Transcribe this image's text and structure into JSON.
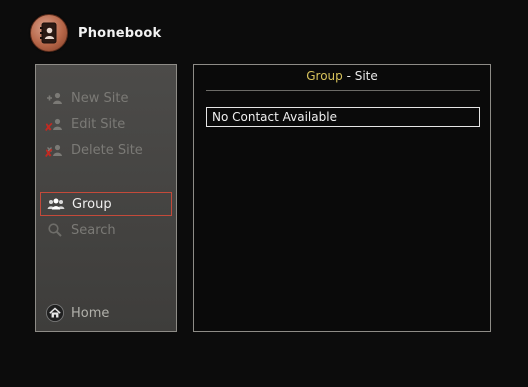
{
  "app": {
    "title": "Phonebook",
    "icon": "address-book-icon"
  },
  "sidebar": {
    "items": [
      {
        "label": "New Site",
        "icon": "add-contact-icon",
        "enabled": false
      },
      {
        "label": "Edit Site",
        "icon": "edit-contact-icon",
        "enabled": false
      },
      {
        "label": "Delete Site",
        "icon": "delete-contact-icon",
        "enabled": false
      },
      {
        "label": "Group",
        "icon": "group-icon",
        "selected": true
      },
      {
        "label": "Search",
        "icon": "search-icon",
        "enabled": false
      }
    ],
    "home": {
      "label": "Home",
      "icon": "home-icon"
    }
  },
  "content": {
    "title_group": "Group",
    "title_separator": " - ",
    "title_site": "Site",
    "rows": [
      "No Contact Available"
    ]
  },
  "colors": {
    "background": "#0c0c0c",
    "panel": "#4c4b49",
    "panel_border": "#8e8c87",
    "title_accent": "#d7c25b",
    "selection_border": "#c44a3a",
    "disabled_text": "#7b7a76",
    "disabled_mark": "#c12a22"
  }
}
